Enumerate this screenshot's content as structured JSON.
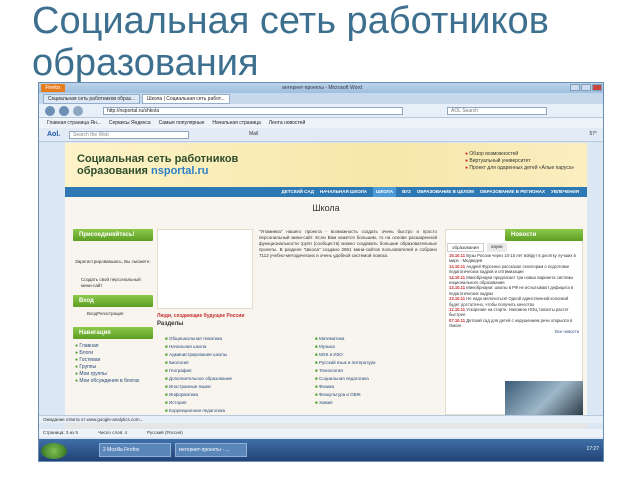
{
  "slide": {
    "title": "Социальная сеть работников образования"
  },
  "browser": {
    "window_title": "интернет-проекты - Microsoft Word",
    "app_button": "Firefox",
    "tabs": [
      {
        "label": "Социальная сеть работников образ..."
      },
      {
        "label": "Школа | Социальная сеть работ..."
      }
    ],
    "url": "http://nsportal.ru/shkola",
    "search_placeholder": "AOL Search",
    "bookmarks": [
      "Главная страница Ян...",
      "Сервисы Яндекса",
      "Самые популярные",
      "Начальная страница",
      "Лента новостей"
    ],
    "aol": {
      "logo": "Aol.",
      "search_placeholder": "Search the Web",
      "mail": "Mail",
      "temp": "57°"
    }
  },
  "site": {
    "logo_line1": "Социальная сеть работников",
    "logo_line2_prefix": "образования ",
    "logo_line2_accent": "nsportal.ru",
    "header_links": [
      "Обзор возможностей",
      "Виртуальный университет",
      "Проект для одаренных детей «Алые паруса»"
    ],
    "menu": [
      "ДЕТСКИЙ САД",
      "НАЧАЛЬНАЯ ШКОЛА",
      "ШКОЛА",
      "ВУЗ",
      "ОБРАЗОВАНИЕ В ЦЕЛОМ",
      "ОБРАЗОВАНИЕ В РЕГИОНАХ",
      "УВЛЕЧЕНИЯ"
    ],
    "section_title": "Школа",
    "join_button": "Присоединяйтесь!",
    "register_text": "Зарегистрировавшись, Вы сможете:",
    "register_benefit": "Создать свой персональный мини-сайт",
    "login_button": "Вход",
    "register_link": "ВходРегистрация",
    "nav_button": "Навигация",
    "nav_items": [
      "Главная",
      "Блоги",
      "Гостевая",
      "Группы",
      "Мои группы",
      "Мои обсуждения в блогах"
    ],
    "promo_caption": "Люди, создающие будущее России",
    "intro_text": "\"Упоминка\" нашего проекта - возможность создать очень быстро и просто персональный мини-сайт. Если Вам кажется большим, то на основе расширенной функциональности групп (сообществ) можно создавать большие образовательные проекты. В разделе \"Школа\" создано 2961 мини-сайтов пользователей и собрано 7113 учебно-методических и очень удобной системой поиска.",
    "sections_title": "Разделы",
    "sections_col1": [
      "Общешкольная тематика",
      "Начальная школа",
      "Администрирование школы",
      "Биология",
      "География",
      "Дополнительное образование",
      "Иностранные языки",
      "Информатика",
      "История",
      "Коррекционная педагогика"
    ],
    "sections_col2": [
      "Математика",
      "Музыка",
      "МХК и ИЗО",
      "Русский язык и литература",
      "Технология",
      "Социальная педагогика",
      "Физика",
      "Физкультура и ОБЖ",
      "Химия"
    ],
    "news_button": "Новости",
    "news_tabs": [
      "образования",
      "науки"
    ],
    "news": [
      {
        "date": "15.10.11",
        "text": "Вузы России через 10-15 лет войдут в десятку лучших в мире - Медведев"
      },
      {
        "date": "14.10.11",
        "text": "Андрей Фурсенко рассказал сенаторам о подготовке педагогических кадров и оптимизации"
      },
      {
        "date": "14.10.11",
        "text": "Минобрнауки предлагает три новых варианта системы национального образования"
      },
      {
        "date": "13.10.11",
        "text": "Минобрнауки: школы в РФ не испытывают дефицита в педагогических кадрах"
      },
      {
        "date": "13.10.11",
        "text": "Не надо мелочиться! Одной единственной колонкой будет достаточно, чтобы получить качество"
      },
      {
        "date": "12.10.11",
        "text": "Ускорение на старте. Напомню НОЦ таланты растет быстрее"
      },
      {
        "date": "07.10.11",
        "text": "Детский сад для детей с нарушением речи открылся в Омске"
      }
    ],
    "news_all": "Все новости"
  },
  "status": {
    "text": "Ожидание ответа от www.google-analytics.com...",
    "page_info": "Страница: 3 из 5",
    "word_count": "Число слов: 4",
    "language": "Русский (Россия)"
  },
  "taskbar": {
    "items": [
      "2 Mozilla Firefox",
      "интернет-проекты - ..."
    ],
    "clock": "17:27"
  }
}
